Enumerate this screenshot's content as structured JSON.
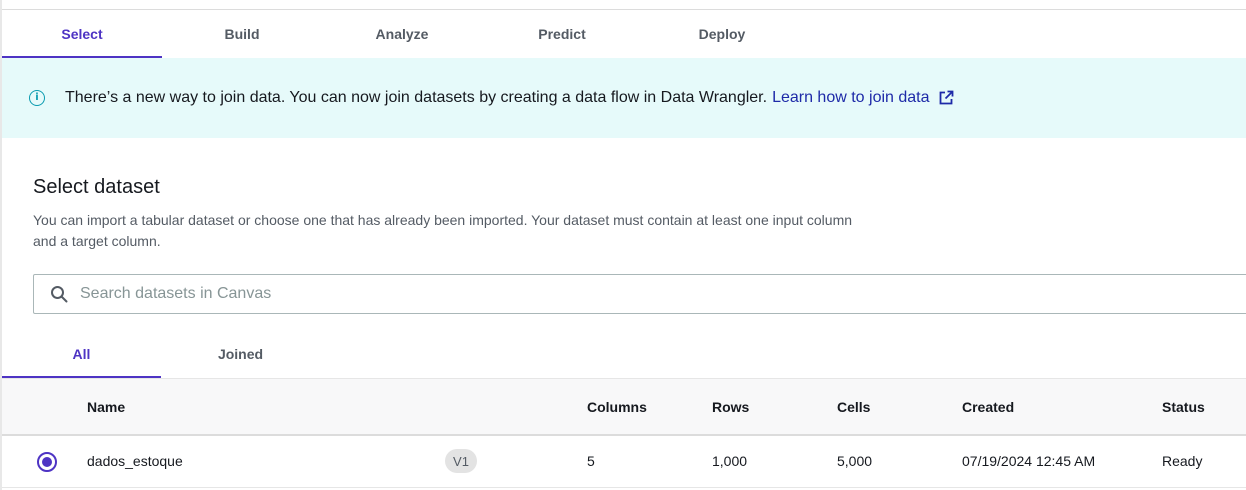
{
  "tabs": [
    {
      "label": "Select",
      "active": true
    },
    {
      "label": "Build",
      "active": false
    },
    {
      "label": "Analyze",
      "active": false
    },
    {
      "label": "Predict",
      "active": false
    },
    {
      "label": "Deploy",
      "active": false
    }
  ],
  "banner": {
    "icon": "info-icon",
    "text": "There’s a new way to join data. You can now join datasets by creating a data flow in Data Wrangler.",
    "link_label": "Learn how to join data",
    "link_icon": "external-link-icon"
  },
  "select_dataset": {
    "title": "Select dataset",
    "description": "You can import a tabular dataset or choose one that has already been imported. Your dataset must contain at least one input column and a target column."
  },
  "search": {
    "placeholder": "Search datasets in Canvas",
    "value": ""
  },
  "subtabs": [
    {
      "label": "All",
      "active": true
    },
    {
      "label": "Joined",
      "active": false
    }
  ],
  "table": {
    "columns": [
      "Name",
      "Columns",
      "Rows",
      "Cells",
      "Created",
      "Status"
    ],
    "rows": [
      {
        "selected": true,
        "name": "dados_estoque",
        "version": "V1",
        "columns": "5",
        "rows": "1,000",
        "cells": "5,000",
        "created": "07/19/2024 12:45 AM",
        "status": "Ready"
      }
    ]
  },
  "colors": {
    "accent": "#4e34c4",
    "banner_bg": "#e6fafa",
    "info": "#0b9bb0",
    "link": "#1e2aa8"
  }
}
